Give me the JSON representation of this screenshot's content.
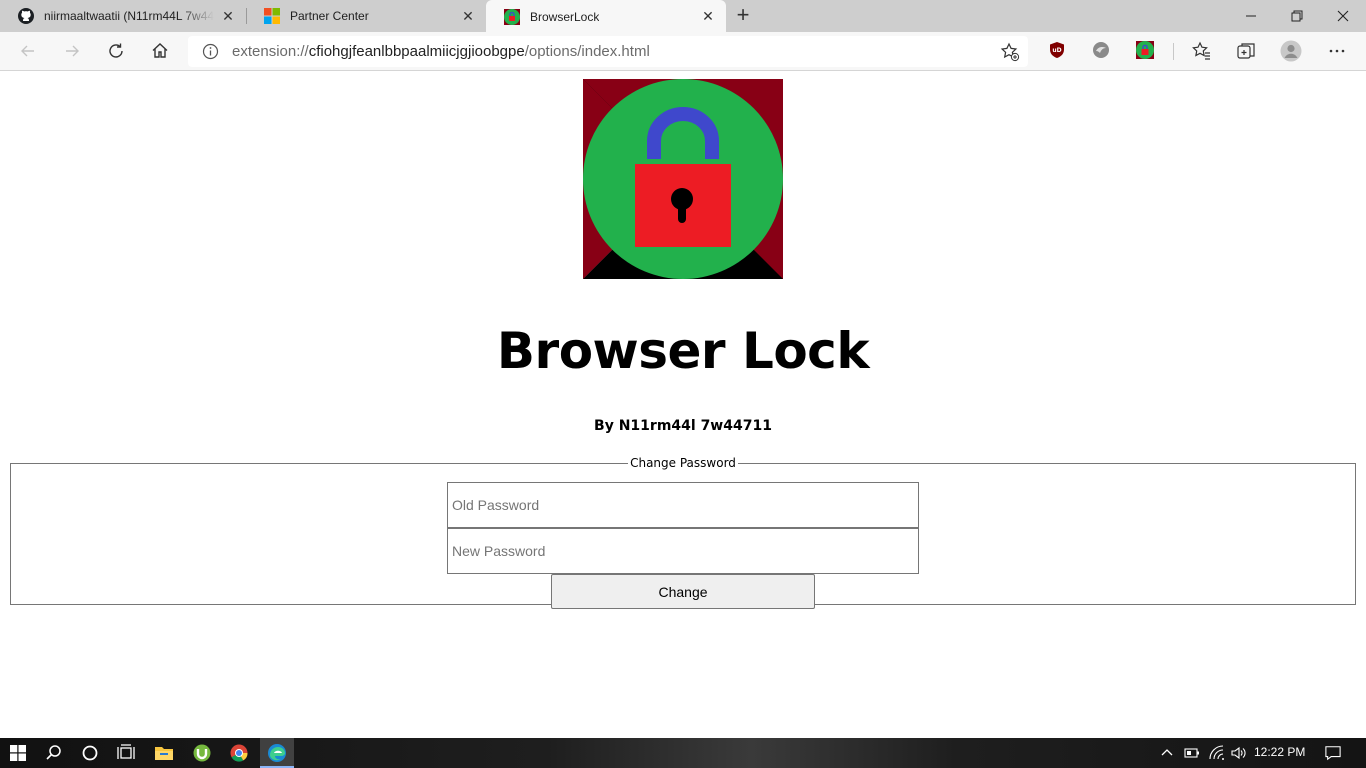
{
  "browser": {
    "tabs": [
      {
        "title": "niirmaaltwaatii (N11rm44L 7w44",
        "favicon": "github-icon"
      },
      {
        "title": "Partner Center",
        "favicon": "microsoft-icon"
      },
      {
        "title": "BrowserLock",
        "favicon": "browserlock-icon"
      }
    ],
    "url_dim_prefix": "extension://",
    "url_host": "cfiohgjfeanlbbpaalmiicjgjioobgpe",
    "url_path": "/options/index.html"
  },
  "page": {
    "heading": "Browser Lock",
    "byline": "By N11rm44l 7w44711",
    "form": {
      "legend": "Change Password",
      "old_placeholder": "Old Password",
      "new_placeholder": "New Password",
      "button_label": "Change"
    }
  },
  "taskbar": {
    "clock": "12:22 PM"
  },
  "colors": {
    "lock_circle": "#22b14c",
    "lock_body": "#ed1c24",
    "lock_shackle": "#3f48cc",
    "logo_bg_dark_red": "#880015"
  }
}
